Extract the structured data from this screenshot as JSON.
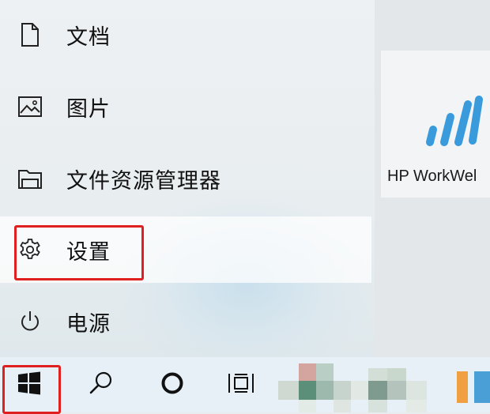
{
  "start_menu": {
    "items": [
      {
        "label": "文档",
        "icon": "document-icon"
      },
      {
        "label": "图片",
        "icon": "pictures-icon"
      },
      {
        "label": "文件资源管理器",
        "icon": "file-explorer-icon"
      },
      {
        "label": "设置",
        "icon": "gear-icon"
      },
      {
        "label": "电源",
        "icon": "power-icon"
      }
    ]
  },
  "tiles": [
    {
      "label": "HP WorkWel",
      "icon": "hp-workwell-icon"
    }
  ],
  "taskbar": {
    "buttons": [
      {
        "icon": "windows-logo-icon"
      },
      {
        "icon": "search-icon"
      },
      {
        "icon": "cortana-icon"
      },
      {
        "icon": "task-view-icon"
      }
    ]
  },
  "colors": {
    "highlight": "#e0201e",
    "tile_icon_blue": "#3a9bdc"
  }
}
